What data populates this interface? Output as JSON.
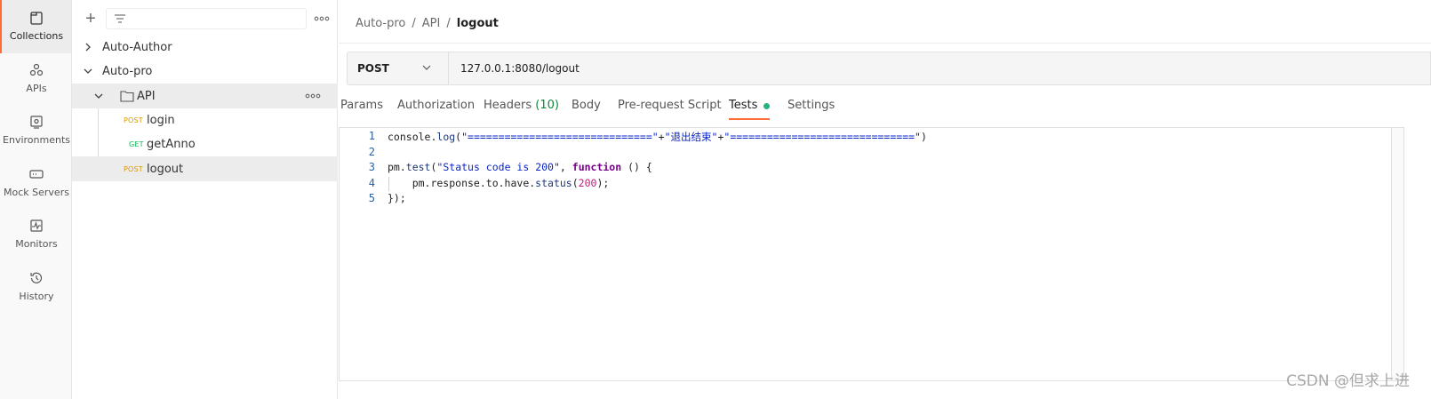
{
  "rail": {
    "items": [
      {
        "label": "Collections",
        "icon": "collections-icon",
        "active": true
      },
      {
        "label": "APIs",
        "icon": "apis-icon"
      },
      {
        "label": "Environments",
        "icon": "environments-icon"
      },
      {
        "label": "Mock Servers",
        "icon": "mock-servers-icon"
      },
      {
        "label": "Monitors",
        "icon": "monitors-icon"
      },
      {
        "label": "History",
        "icon": "history-icon"
      }
    ]
  },
  "sidebar": {
    "filter_placeholder": "",
    "tree": {
      "collection1": "Auto-Author",
      "collection2": "Auto-pro",
      "folder": "API",
      "requests": [
        {
          "method": "POST",
          "name": "login"
        },
        {
          "method": "GET",
          "name": "getAnno"
        },
        {
          "method": "POST",
          "name": "logout"
        }
      ]
    }
  },
  "breadcrumb": {
    "part1": "Auto-pro",
    "part2": "API",
    "current": "logout",
    "sep": "/"
  },
  "request": {
    "method": "POST",
    "url": "127.0.0.1:8080/logout"
  },
  "tabs": {
    "params": "Params",
    "authorization": "Authorization",
    "headers": "Headers",
    "headers_count": "(10)",
    "body": "Body",
    "prerequest": "Pre-request Script",
    "tests": "Tests",
    "settings": "Settings"
  },
  "editor": {
    "line_numbers": [
      "1",
      "2",
      "3",
      "4",
      "5"
    ],
    "line1": {
      "a": "console.",
      "b": "log",
      "c": "(",
      "d": "\"==============================\"",
      "e": "+",
      "f": "\"退出结束\"",
      "g": "+",
      "h": "\"==============================\"",
      "i": ")"
    },
    "line3": {
      "a": "pm.",
      "b": "test",
      "c": "(",
      "d": "\"Status code is 200\"",
      "e": ", ",
      "f": "function",
      "g": " () {"
    },
    "line4": {
      "a": "    pm.response.to.have.",
      "b": "status",
      "c": "(",
      "d": "200",
      "e": ");"
    },
    "line5": {
      "a": "});"
    }
  },
  "watermark": "CSDN @但求上进",
  "colors": {
    "accent": "#ff6c37",
    "post": "#d69600",
    "get": "#0cbb52",
    "tests_dot": "#26b47a"
  }
}
